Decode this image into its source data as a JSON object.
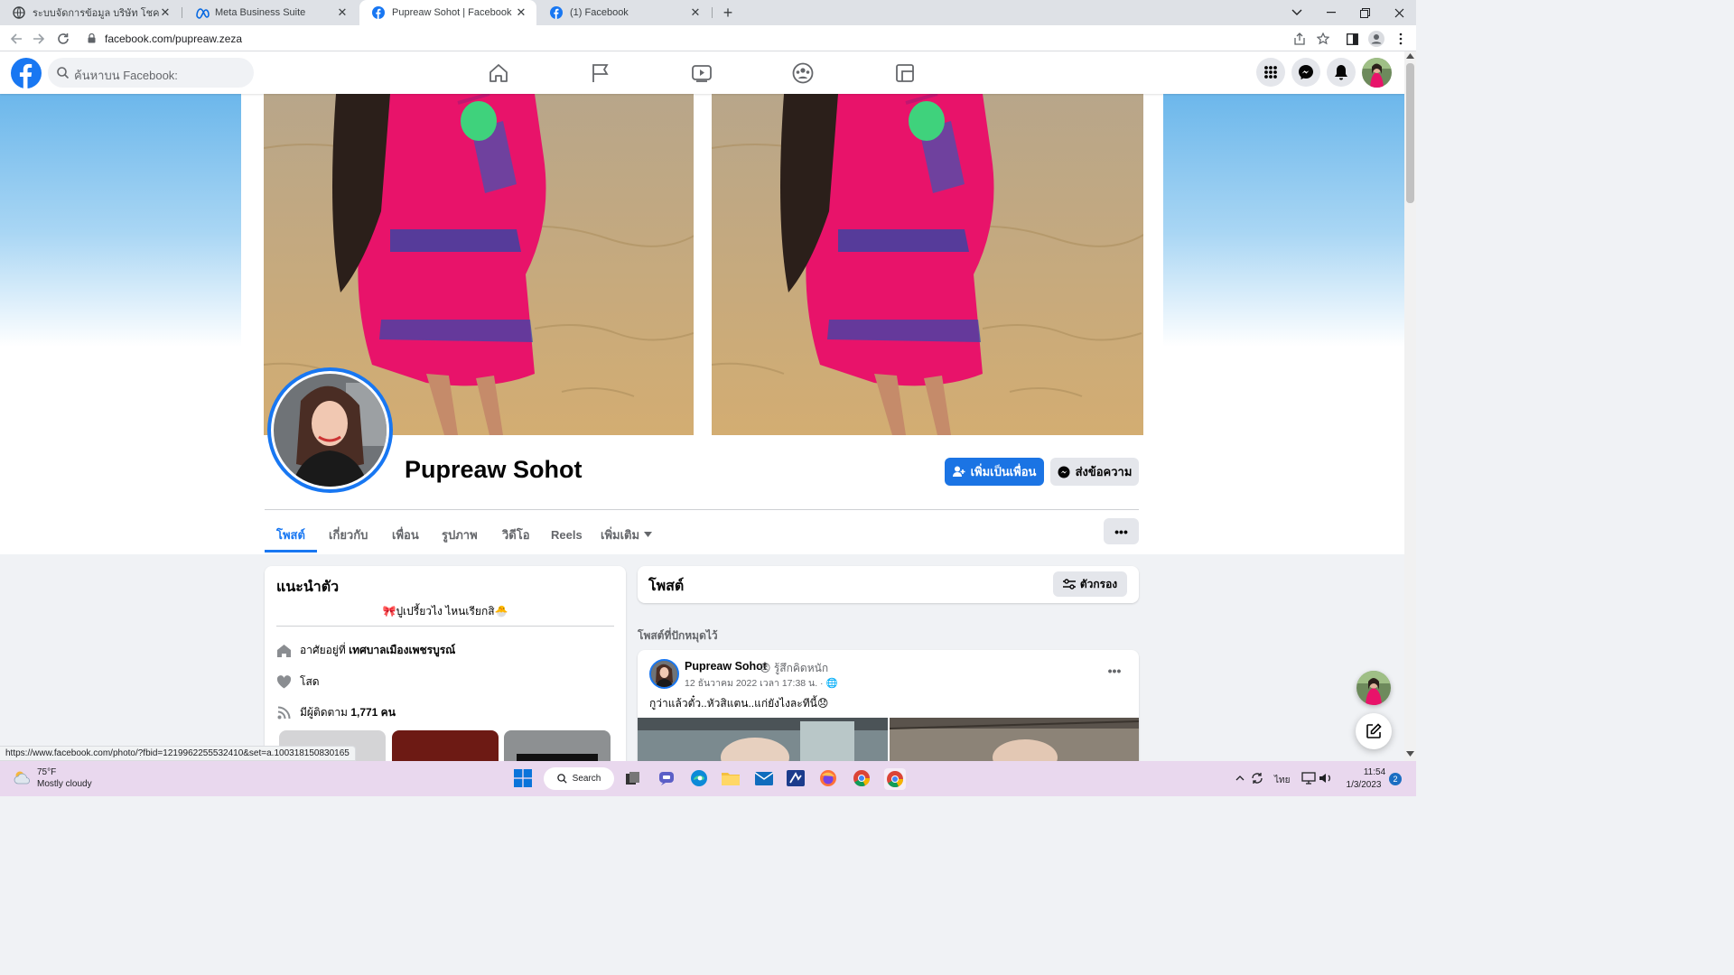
{
  "browser": {
    "tabs": [
      {
        "title": "ระบบจัดการข้อมูล บริษัท โชคลูกน็อต ..."
      },
      {
        "title": "Meta Business Suite"
      },
      {
        "title": "Pupreaw Sohot | Facebook"
      },
      {
        "title": "(1) Facebook"
      }
    ],
    "active_tab": 2,
    "new_tab": "+",
    "url": "facebook.com/pupreaw.zeza",
    "status_url": "https://www.facebook.com/photo/?fbid=121996225553241​0&set=a.100318150830165"
  },
  "header": {
    "search_placeholder": "ค้นหาบน Facebook:"
  },
  "profile": {
    "name": "Pupreaw Sohot",
    "add_friend_label": "เพิ่มเป็นเพื่อน",
    "message_label": "ส่งข้อความ",
    "tabs": [
      {
        "label": "โพสต์"
      },
      {
        "label": "เกี่ยวกับ"
      },
      {
        "label": "เพื่อน"
      },
      {
        "label": "รูปภาพ"
      },
      {
        "label": "วิดีโอ"
      },
      {
        "label": "Reels"
      },
      {
        "label": "เพิ่มเติม"
      }
    ],
    "more_label": "•••"
  },
  "intro": {
    "title": "แนะนำตัว",
    "bio": "🎀ปูเปรี้ยวไง ไหนเรียกสิ🐣",
    "lives_prefix": "อาศัยอยู่ที่ ",
    "lives_in": "เทศบาลเมืองเพชรบูรณ์",
    "relationship": "โสด",
    "followers_prefix": "มีผู้ติดตาม ",
    "followers": "1,771 คน"
  },
  "posts": {
    "title": "โพสต์",
    "filter_label": "ตัวกรอง",
    "pinned_label": "โพสต์ที่ปักหมุดไว้",
    "post": {
      "author": "Pupreaw Sohot",
      "feeling": "😣 รู้สึกคิดหนัก",
      "time": "12 ธันวาคม 2022 เวลา 17:38 น. · 🌐",
      "text": "กูว่าแล้วตั๋ว..หัวสิแตน..แก่ยังไงละทีนี้😞",
      "menu": "•••"
    }
  },
  "taskbar": {
    "weather_temp": "75°F",
    "weather_desc": "Mostly cloudy",
    "search_label": "Search",
    "lang": "ไทย",
    "time": "11:54",
    "date": "1/3/2023",
    "notifications": "2"
  },
  "colors": {
    "fb_blue": "#1877f2",
    "button_blue": "#1b74e4",
    "taskbar": "#e9d8ee"
  }
}
